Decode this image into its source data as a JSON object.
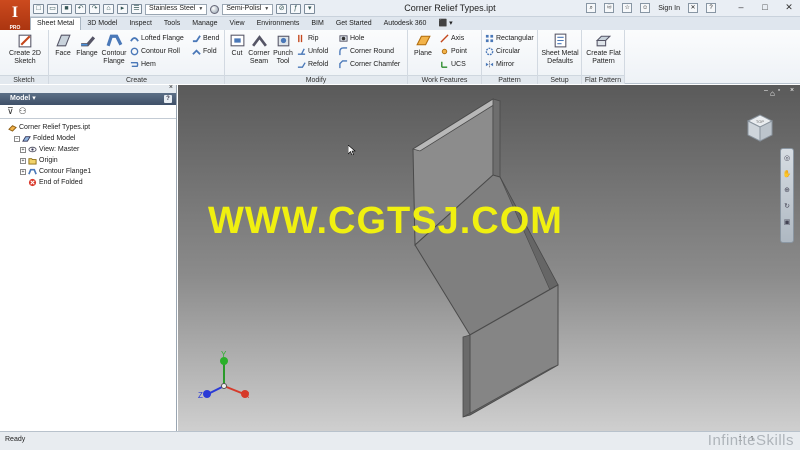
{
  "app": {
    "button_label": "I",
    "button_sub": "PRO"
  },
  "window": {
    "title": "Corner Relief Types.ipt"
  },
  "quick_access": {
    "material": "Stainless Steel",
    "appearance": "Semi-Polisl"
  },
  "title_right": {
    "sign_in": "Sign In"
  },
  "tabs": [
    "Sheet Metal",
    "3D Model",
    "Inspect",
    "Tools",
    "Manage",
    "View",
    "Environments",
    "BIM",
    "Get Started",
    "Autodesk 360",
    "⬛ ▾"
  ],
  "ribbon": {
    "sketch": {
      "title": "Sketch",
      "create_2d_sketch": "Create 2D Sketch"
    },
    "create": {
      "title": "Create",
      "face": "Face",
      "flange": "Flange",
      "contour_flange": "Contour Flange",
      "lofted_flange": "Lofted Flange",
      "contour_roll": "Contour Roll",
      "hem": "Hem",
      "bend": "Bend",
      "fold": "Fold"
    },
    "modify": {
      "title": "Modify",
      "cut": "Cut",
      "corner_seam": "Corner Seam",
      "punch_tool": "Punch Tool",
      "rip": "Rip",
      "unfold": "Unfold",
      "refold": "Refold",
      "hole": "Hole",
      "corner_round": "Corner Round",
      "corner_chamfer": "Corner Chamfer"
    },
    "work_features": {
      "title": "Work Features",
      "plane": "Plane",
      "axis": "Axis",
      "point": "Point",
      "ucs": "UCS"
    },
    "pattern": {
      "title": "Pattern",
      "rectangular": "Rectangular",
      "circular": "Circular",
      "mirror": "Mirror"
    },
    "setup": {
      "title": "Setup",
      "sheet_metal_defaults": "Sheet Metal Defaults"
    },
    "flat_pattern": {
      "title": "Flat Pattern",
      "create_flat_pattern": "Create Flat Pattern"
    }
  },
  "browser": {
    "header": "Model",
    "tree": {
      "root": "Corner Relief Types.ipt",
      "folded_model": "Folded Model",
      "view_master": "View: Master",
      "origin": "Origin",
      "contour_flange": "Contour Flange1",
      "end_of_folded": "End of Folded"
    }
  },
  "viewport": {
    "watermark": "WWW.CGTSJ.COM",
    "triad": {
      "x": "X",
      "y": "Y",
      "z": "Z"
    }
  },
  "status": {
    "text": "Ready",
    "count_a": "1",
    "count_b": "1",
    "brand": "InfiniteSkills"
  },
  "colors": {
    "ribbon_bg": "#eef2f6",
    "accent": "#c4461b",
    "watermark": "#f0f010"
  }
}
